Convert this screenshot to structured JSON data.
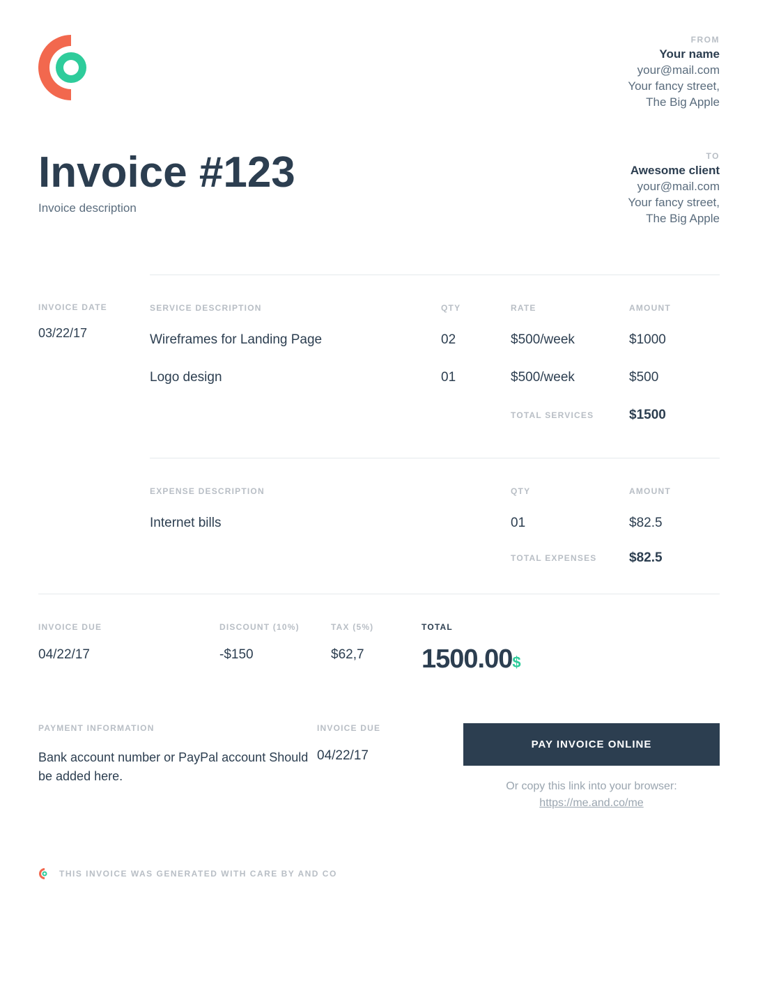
{
  "from": {
    "label": "FROM",
    "name": "Your name",
    "email": "your@mail.com",
    "street": "Your fancy street,",
    "city": "The Big Apple"
  },
  "to": {
    "label": "TO",
    "name": "Awesome client",
    "email": "your@mail.com",
    "street": "Your fancy street,",
    "city": "The Big Apple"
  },
  "invoice": {
    "title": "Invoice #123",
    "description": "Invoice description",
    "date_label": "INVOICE DATE",
    "date": "03/22/17"
  },
  "services": {
    "headers": {
      "desc": "SERVICE DESCRIPTION",
      "qty": "QTY",
      "rate": "RATE",
      "amount": "AMOUNT"
    },
    "rows": [
      {
        "desc": "Wireframes for Landing Page",
        "qty": "02",
        "rate": "$500/week",
        "amount": "$1000"
      },
      {
        "desc": "Logo design",
        "qty": "01",
        "rate": "$500/week",
        "amount": "$500"
      }
    ],
    "total_label": "TOTAL SERVICES",
    "total": "$1500"
  },
  "expenses": {
    "headers": {
      "desc": "EXPENSE DESCRIPTION",
      "qty": "QTY",
      "amount": "AMOUNT"
    },
    "rows": [
      {
        "desc": "Internet bills",
        "qty": "01",
        "amount": "$82.5"
      }
    ],
    "total_label": "TOTAL EXPENSES",
    "total": "$82.5"
  },
  "totals": {
    "due_label": "INVOICE DUE",
    "due_date": "04/22/17",
    "discount_label": "DISCOUNT (10%)",
    "discount": "-$150",
    "tax_label": "TAX (5%)",
    "tax": "$62,7",
    "total_label": "TOTAL",
    "total": "1500.00",
    "currency": "$"
  },
  "payment": {
    "info_label": "PAYMENT INFORMATION",
    "info_text": "Bank account number or PayPal account Should be added here.",
    "due_label": "INVOICE DUE",
    "due_date": "04/22/17",
    "button": "PAY INVOICE ONLINE",
    "copy_text": "Or copy this link into your browser: ",
    "copy_link": "https://me.and.co/me"
  },
  "footer": {
    "text": "THIS INVOICE WAS GENERATED WITH CARE BY AND CO"
  }
}
